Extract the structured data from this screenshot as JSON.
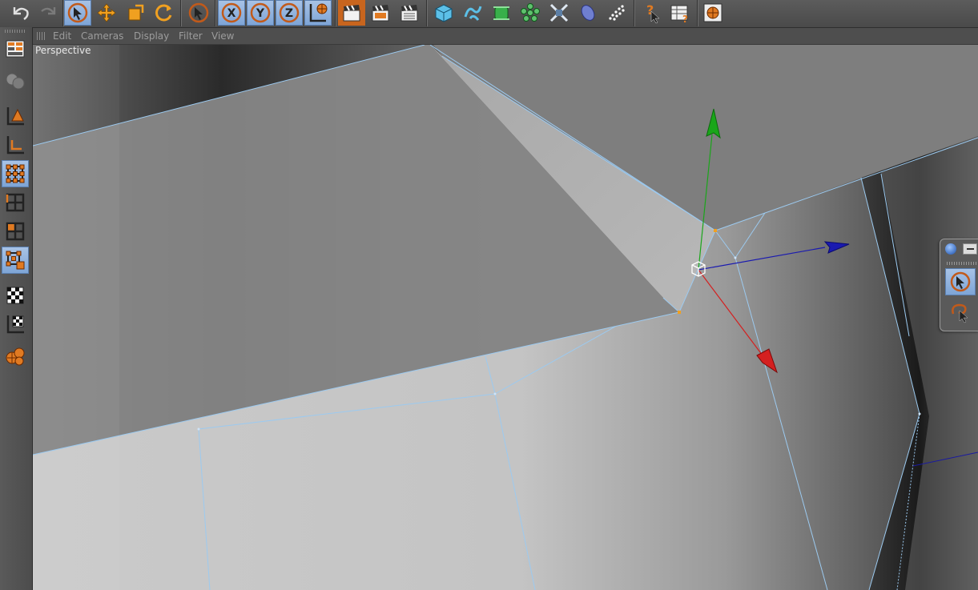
{
  "viewport_menu": {
    "items": [
      "Edit",
      "Cameras",
      "Display",
      "Filter",
      "View"
    ]
  },
  "viewport": {
    "label": "Perspective"
  },
  "toolbar": {
    "icons": [
      "undo-icon",
      "redo-icon",
      "live-selection-icon",
      "move-icon",
      "scale-icon",
      "rotate-icon",
      "last-tool-icon",
      "x-axis-lock-icon",
      "y-axis-lock-icon",
      "z-axis-lock-icon",
      "coordinate-system-icon",
      "render-view-icon",
      "render-picture-viewer-icon",
      "render-settings-icon",
      "cube-object-icon",
      "spline-pen-icon",
      "nurbs-icon",
      "array-icon",
      "deformer-icon",
      "scene-object-icon",
      "particle-icon",
      "help-icon",
      "layer-browser-icon",
      "web-browser-icon"
    ]
  },
  "sidebar": {
    "icons": [
      "layout-icon",
      "model-mode-icon",
      "object-axis-icon",
      "axis-mode-icon",
      "points-mode-icon",
      "edges-mode-icon",
      "polygons-mode-icon",
      "uv-points-icon",
      "texture-mode-icon",
      "texture-axis-icon",
      "material-spheres-icon"
    ]
  },
  "palette": {
    "icons": [
      "move-selection-icon",
      "lasso-selection-icon"
    ]
  },
  "colors": {
    "accent_orange": "#e07a22",
    "active_blue": "#8fb2de",
    "axis_x": "#d42020",
    "axis_y": "#1aa61a",
    "axis_z": "#1a1ab0",
    "edge_highlight": "#9ccaf0"
  }
}
